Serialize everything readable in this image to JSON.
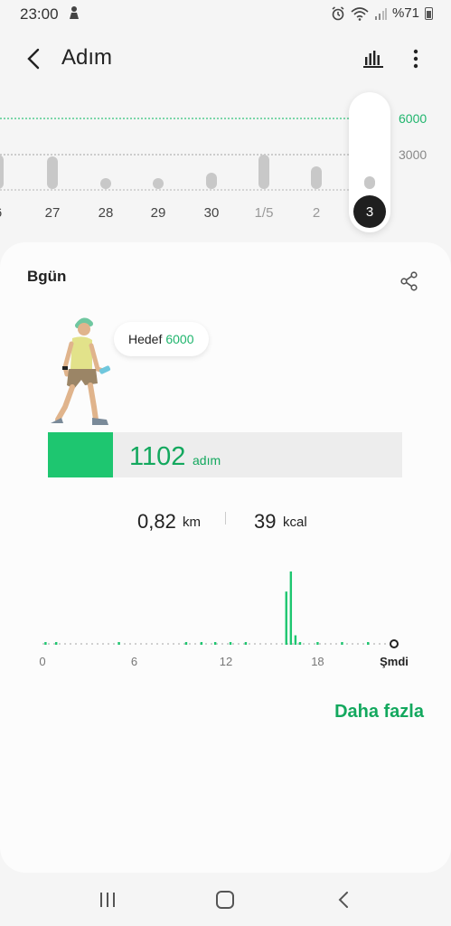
{
  "status_bar": {
    "time": "23:00",
    "battery": "%71"
  },
  "app_bar": {
    "title": "Adım"
  },
  "week_strip": {
    "goal_label": "6000",
    "half_label": "3000",
    "days": [
      {
        "label": "6",
        "steps": 2900
      },
      {
        "label": "27",
        "steps": 2700
      },
      {
        "label": "28",
        "steps": 900
      },
      {
        "label": "29",
        "steps": 900
      },
      {
        "label": "30",
        "steps": 1400
      },
      {
        "label": "1/5",
        "steps": 2900
      },
      {
        "label": "2",
        "steps": 1900
      }
    ],
    "selected": {
      "label": "3",
      "steps": 1102
    }
  },
  "card": {
    "title": "Bgün",
    "goal_prefix": "Hedef",
    "goal_value": "6000",
    "steps_value": "1102",
    "steps_unit": "adım",
    "progress_fraction": 0.1837,
    "distance_value": "0,82",
    "distance_unit": "km",
    "calories_value": "39",
    "calories_unit": "kcal",
    "more_label": "Daha fazla"
  },
  "chart_data": {
    "type": "bar",
    "title": "",
    "xlabel": "",
    "ylabel": "",
    "x_ticks": [
      "0",
      "6",
      "12",
      "18",
      "Şmdi"
    ],
    "x_tick_hours": [
      0,
      6,
      12,
      18,
      23
    ],
    "bars": [
      {
        "hour": 0.2,
        "value": 10
      },
      {
        "hour": 0.9,
        "value": 10
      },
      {
        "hour": 5.0,
        "value": 10
      },
      {
        "hour": 9.4,
        "value": 10
      },
      {
        "hour": 10.4,
        "value": 10
      },
      {
        "hour": 11.3,
        "value": 10
      },
      {
        "hour": 12.3,
        "value": 10
      },
      {
        "hour": 13.3,
        "value": 10
      },
      {
        "hour": 15.95,
        "value": 450
      },
      {
        "hour": 16.25,
        "value": 620
      },
      {
        "hour": 16.55,
        "value": 80
      },
      {
        "hour": 16.85,
        "value": 20
      },
      {
        "hour": 18.0,
        "value": 10
      },
      {
        "hour": 19.6,
        "value": 10
      },
      {
        "hour": 21.3,
        "value": 10
      }
    ],
    "ylim": [
      0,
      650
    ],
    "xlim": [
      0,
      23
    ],
    "color": "#1ec670"
  },
  "colors": {
    "accent": "#1ec670",
    "accent_text": "#13a85e"
  }
}
